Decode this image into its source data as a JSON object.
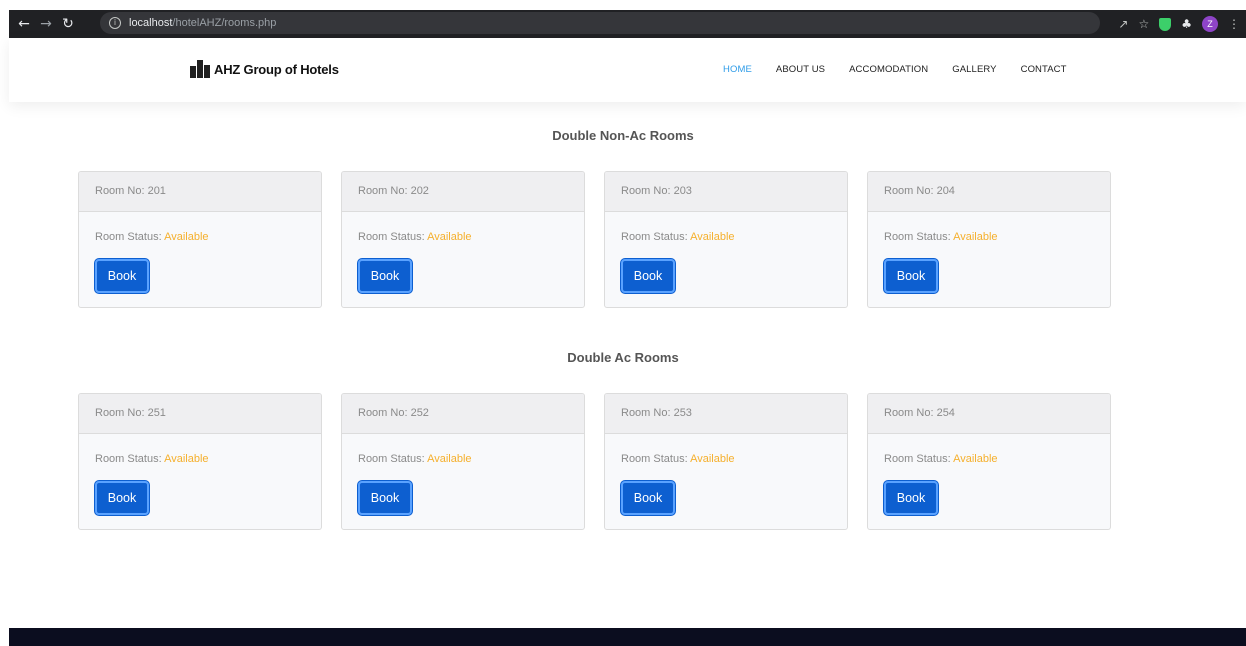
{
  "browser": {
    "url_host": "localhost",
    "url_path": "/hotelAHZ/rooms.php",
    "profile_initial": "Z"
  },
  "site": {
    "brand": "AHZ Group of Hotels",
    "nav": [
      {
        "label": "HOME",
        "active": true
      },
      {
        "label": "ABOUT US",
        "active": false
      },
      {
        "label": "ACCOMODATION",
        "active": false
      },
      {
        "label": "GALLERY",
        "active": false
      },
      {
        "label": "CONTACT",
        "active": false
      }
    ]
  },
  "sections": [
    {
      "title": "Double Non-Ac Rooms",
      "rooms": [
        {
          "label": "Room No: 201",
          "status_label": "Room Status:",
          "status": "Available",
          "button": "Book"
        },
        {
          "label": "Room No: 202",
          "status_label": "Room Status:",
          "status": "Available",
          "button": "Book"
        },
        {
          "label": "Room No: 203",
          "status_label": "Room Status:",
          "status": "Available",
          "button": "Book"
        },
        {
          "label": "Room No: 204",
          "status_label": "Room Status:",
          "status": "Available",
          "button": "Book"
        }
      ]
    },
    {
      "title": "Double Ac Rooms",
      "rooms": [
        {
          "label": "Room No: 251",
          "status_label": "Room Status:",
          "status": "Available",
          "button": "Book"
        },
        {
          "label": "Room No: 252",
          "status_label": "Room Status:",
          "status": "Available",
          "button": "Book"
        },
        {
          "label": "Room No: 253",
          "status_label": "Room Status:",
          "status": "Available",
          "button": "Book"
        },
        {
          "label": "Room No: 254",
          "status_label": "Room Status:",
          "status": "Available",
          "button": "Book"
        }
      ]
    }
  ],
  "colors": {
    "accent_nav": "#2f9ce8",
    "available": "#f5b02d",
    "button": "#0d5fd0",
    "footer": "#0b0d1f"
  }
}
